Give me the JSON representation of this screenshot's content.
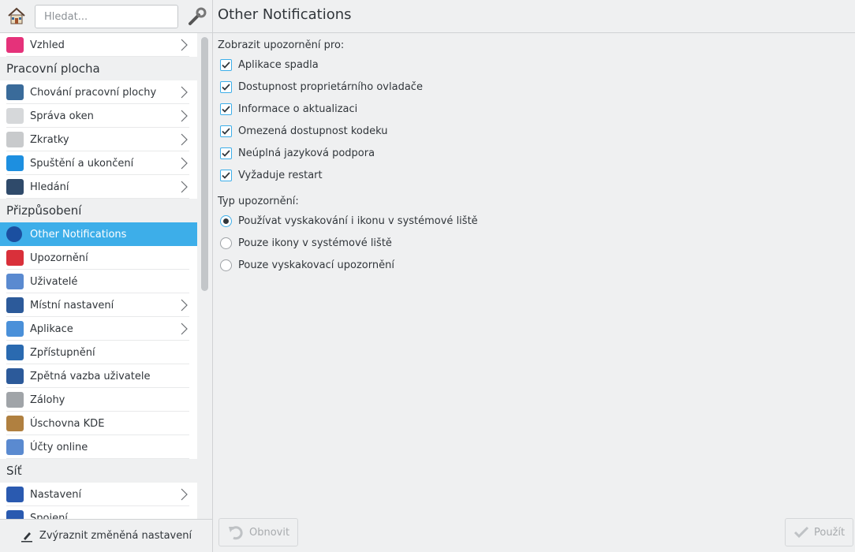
{
  "header": {
    "search_placeholder": "Hledat...",
    "title": "Other Notifications"
  },
  "sidebar": [
    {
      "type": "item",
      "label": "Vzhled",
      "icon": "appearance-icon",
      "color": "#e5327a",
      "chev": true
    },
    {
      "type": "section",
      "label": "Pracovní plocha"
    },
    {
      "type": "item",
      "label": "Chování pracovní plochy",
      "icon": "desktop-behavior-icon",
      "color": "#3a6b9a",
      "chev": true
    },
    {
      "type": "item",
      "label": "Správa oken",
      "icon": "window-management-icon",
      "color": "#d6d8da",
      "chev": true
    },
    {
      "type": "item",
      "label": "Zkratky",
      "icon": "shortcuts-icon",
      "color": "#c8cacc",
      "chev": true
    },
    {
      "type": "item",
      "label": "Spuštění a ukončení",
      "icon": "startup-shutdown-icon",
      "color": "#1d8fe0",
      "chev": true
    },
    {
      "type": "item",
      "label": "Hledání",
      "icon": "binoculars-icon",
      "color": "#2f4a6a",
      "chev": true
    },
    {
      "type": "section",
      "label": "Přizpůsobení"
    },
    {
      "type": "item",
      "label": "Other Notifications",
      "icon": "info-notification-icon",
      "color": "#1b4fa0",
      "chev": false,
      "selected": true
    },
    {
      "type": "item",
      "label": "Upozornění",
      "icon": "bell-icon",
      "color": "#d9303a",
      "chev": false
    },
    {
      "type": "item",
      "label": "Uživatelé",
      "icon": "users-icon",
      "color": "#5a8ad0",
      "chev": false
    },
    {
      "type": "item",
      "label": "Místní nastavení",
      "icon": "locale-icon",
      "color": "#2c5a9a",
      "chev": true
    },
    {
      "type": "item",
      "label": "Aplikace",
      "icon": "applications-icon",
      "color": "#4a90d9",
      "chev": true
    },
    {
      "type": "item",
      "label": "Zpřístupnění",
      "icon": "accessibility-icon",
      "color": "#2a6ab0",
      "chev": false
    },
    {
      "type": "item",
      "label": "Zpětná vazba uživatele",
      "icon": "feedback-icon",
      "color": "#2c5a9a",
      "chev": false
    },
    {
      "type": "item",
      "label": "Zálohy",
      "icon": "backup-icon",
      "color": "#a0a4a8",
      "chev": false
    },
    {
      "type": "item",
      "label": "Úschovna KDE",
      "icon": "vault-icon",
      "color": "#b08040",
      "chev": false
    },
    {
      "type": "item",
      "label": "Účty online",
      "icon": "online-accounts-icon",
      "color": "#5a8ad0",
      "chev": false
    },
    {
      "type": "section",
      "label": "Síť"
    },
    {
      "type": "item",
      "label": "Nastavení",
      "icon": "network-settings-icon",
      "color": "#2a5ab0",
      "chev": true
    },
    {
      "type": "item",
      "label": "Spojení",
      "icon": "connections-icon",
      "color": "#2a5ab0",
      "chev": false
    }
  ],
  "bottom": {
    "highlight_label": "Zvýraznit změněná nastavení"
  },
  "content": {
    "show_for_label": "Zobrazit upozornění pro:",
    "checkboxes": [
      {
        "label": "Aplikace spadla",
        "checked": true
      },
      {
        "label": "Dostupnost proprietárního ovladače",
        "checked": true
      },
      {
        "label": "Informace o aktualizaci",
        "checked": true
      },
      {
        "label": "Omezená dostupnost kodeku",
        "checked": true
      },
      {
        "label": "Neúplná jazyková podpora",
        "checked": true
      },
      {
        "label": "Vyžaduje restart",
        "checked": true
      }
    ],
    "type_label": "Typ upozornění:",
    "radios": [
      {
        "label": "Používat vyskakování i ikonu v systémové liště",
        "selected": true
      },
      {
        "label": "Pouze ikony v systémové liště",
        "selected": false
      },
      {
        "label": "Pouze vyskakovací upozornění",
        "selected": false
      }
    ]
  },
  "buttons": {
    "reset": "Obnovit",
    "apply": "Použít"
  },
  "colors": {
    "accent": "#3daee9"
  }
}
